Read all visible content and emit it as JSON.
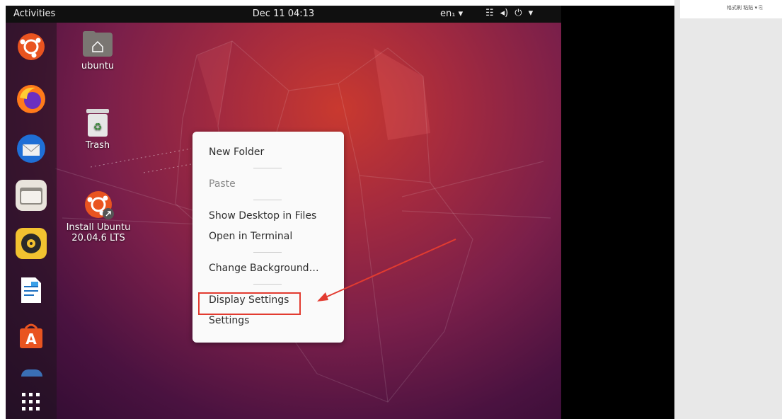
{
  "topbar": {
    "activities": "Activities",
    "clock": "Dec 11  04:13",
    "lang": "en₁ ▾",
    "network_icon": "☷",
    "volume_icon": "◂)",
    "power_icon": "⏻",
    "menu_icon": "▾"
  },
  "desktop": {
    "icons": [
      {
        "label": "ubuntu"
      },
      {
        "label": "Trash"
      },
      {
        "label_line1": "Install Ubuntu",
        "label_line2": "20.04.6 LTS"
      }
    ]
  },
  "context_menu": {
    "new_folder": "New Folder",
    "paste": "Paste",
    "show_desktop": "Show Desktop in Files",
    "open_terminal": "Open in Terminal",
    "change_background": "Change Background…",
    "display_settings": "Display Settings",
    "settings": "Settings"
  },
  "right_panel": {
    "toolbar_text": "格式刷  粘贴 ▾  ⎘"
  },
  "colors": {
    "highlight": "#e23b30",
    "topbar": "#101010",
    "menu_bg": "#fafafa"
  }
}
